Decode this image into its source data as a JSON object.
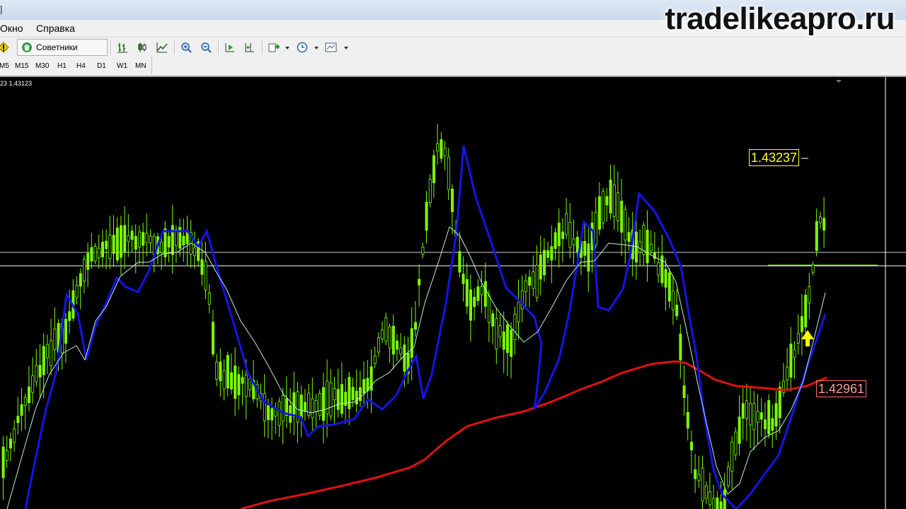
{
  "window": {
    "title_fragment": "]"
  },
  "watermark": "tradelikeapro.ru",
  "menu": {
    "items": [
      "Окно",
      "Справка"
    ]
  },
  "toolbar": {
    "advisors_label": "Советники"
  },
  "timeframes": [
    "M5",
    "M15",
    "M30",
    "H1",
    "H4",
    "D1",
    "W1",
    "MN"
  ],
  "chart": {
    "info_text": "23 1.43123",
    "price_labels": {
      "level_high": "1.43237",
      "ma_value": "1.42961"
    },
    "colors": {
      "background": "#000000",
      "candles": "#7cfc00",
      "ema_slow": "#e01010",
      "band": "#1414e6",
      "ma_fast": "#b8f0e0",
      "signal": "#ffff00"
    }
  }
}
